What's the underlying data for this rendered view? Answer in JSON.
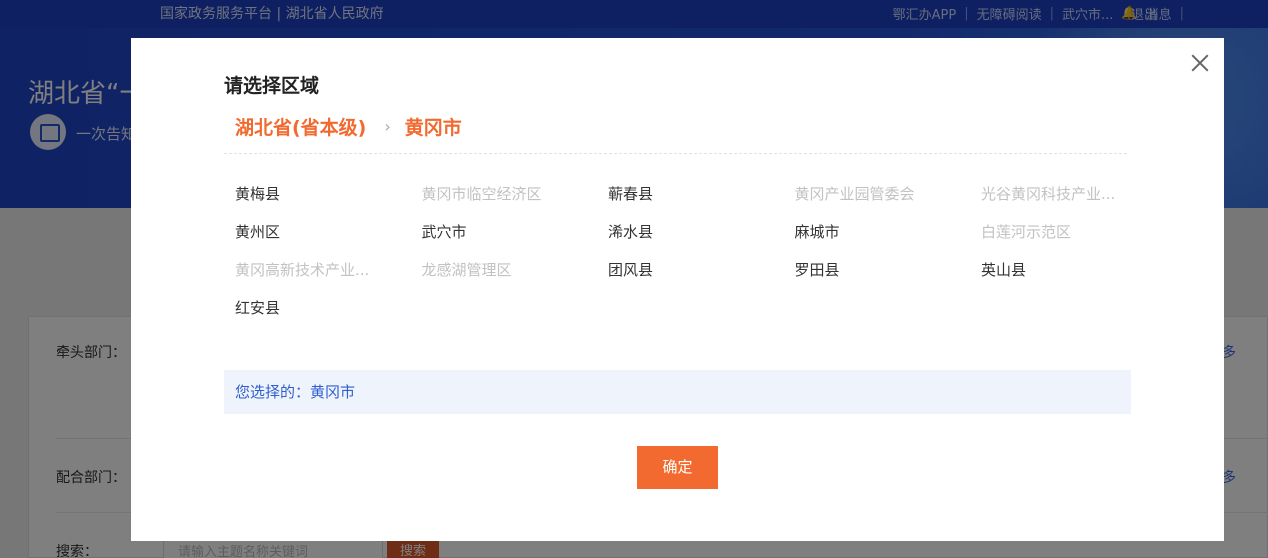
{
  "topbar": {
    "gov_links": "国家政务服务平台 | 湖北省人民政府",
    "right_items": [
      "鄂汇办APP",
      "无障碍阅读",
      "武穴市...",
      "消息"
    ],
    "logout": "退出"
  },
  "banner": {
    "title": "湖北省“一",
    "subtitle": "一次告知"
  },
  "page": {
    "lead_dept_label": "牵头部门：",
    "coop_dept_label": "配合部门：",
    "search_label": "搜索：",
    "search_placeholder": "请输入主题名称关键词",
    "search_button": "搜索",
    "more_label": "多"
  },
  "modal": {
    "title": "请选择区域",
    "breadcrumb": [
      "湖北省(省本级)",
      "黄冈市"
    ],
    "regions": [
      {
        "label": "黄梅县",
        "enabled": true
      },
      {
        "label": "黄冈市临空经济区",
        "enabled": false
      },
      {
        "label": "蕲春县",
        "enabled": true
      },
      {
        "label": "黄冈产业园管委会",
        "enabled": false
      },
      {
        "label": "光谷黄冈科技产业...",
        "enabled": false
      },
      {
        "label": "黄州区",
        "enabled": true
      },
      {
        "label": "武穴市",
        "enabled": true
      },
      {
        "label": "浠水县",
        "enabled": true
      },
      {
        "label": "麻城市",
        "enabled": true
      },
      {
        "label": "白莲河示范区",
        "enabled": false
      },
      {
        "label": "黄冈高新技术产业...",
        "enabled": false
      },
      {
        "label": "龙感湖管理区",
        "enabled": false
      },
      {
        "label": "团风县",
        "enabled": true
      },
      {
        "label": "罗田县",
        "enabled": true
      },
      {
        "label": "英山县",
        "enabled": true
      },
      {
        "label": "红安县",
        "enabled": true
      }
    ],
    "selected_text": "您选择的：黄冈市",
    "confirm_label": "确定"
  },
  "colors": {
    "accent": "#f26a2f",
    "banner_blue": "#2453d8",
    "link_blue": "#2f5fce",
    "disabled_text": "#c2c2c2"
  }
}
